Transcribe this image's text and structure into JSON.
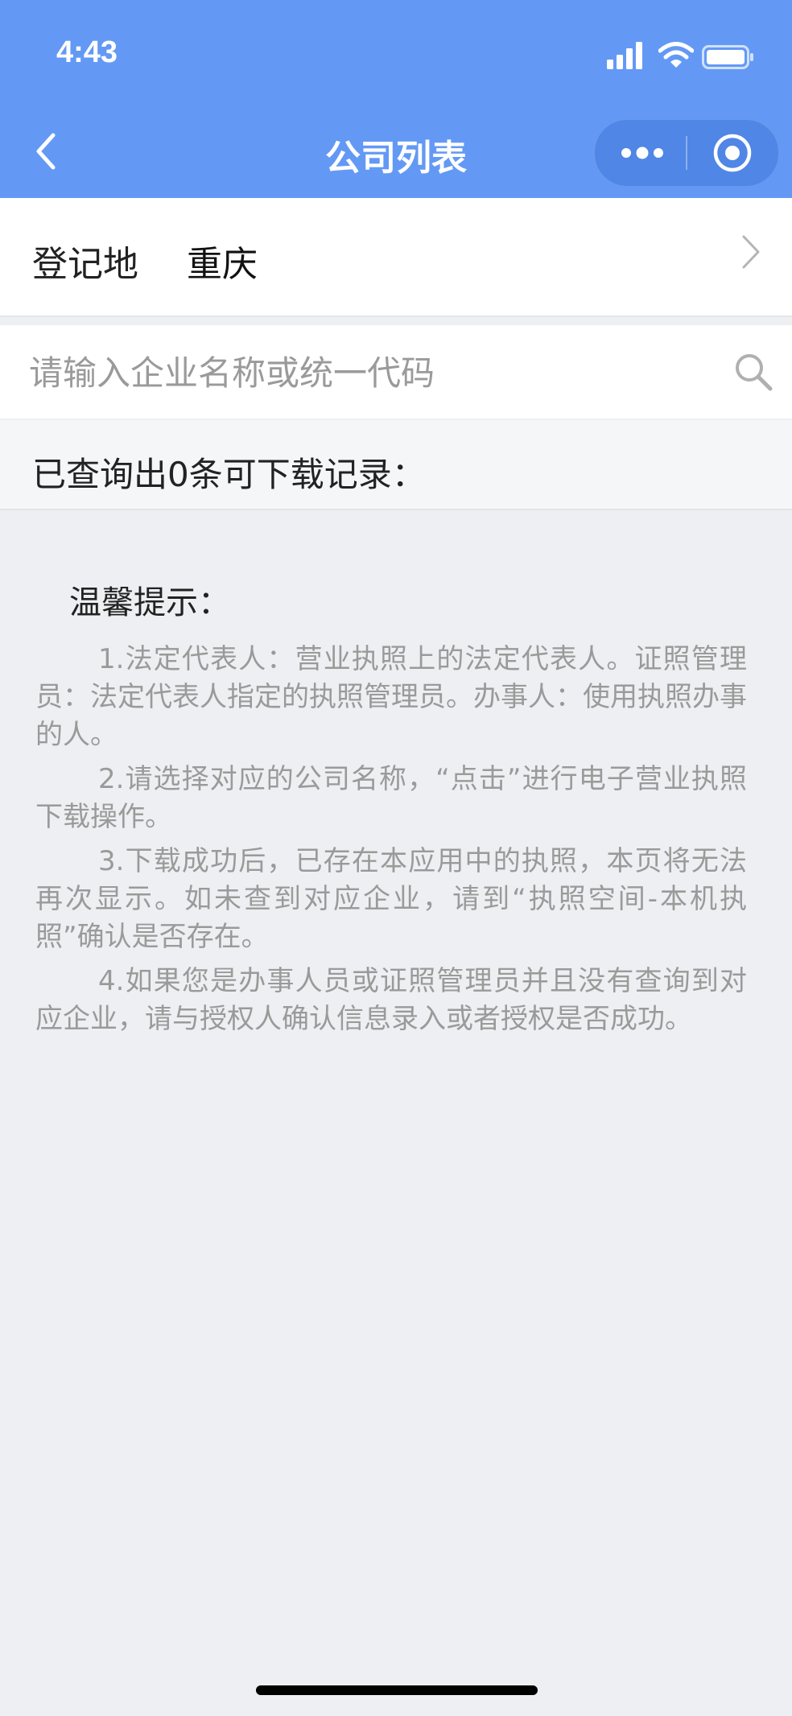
{
  "status_bar": {
    "time": "4:43"
  },
  "nav": {
    "title": "公司列表"
  },
  "region": {
    "label": "登记地",
    "value": "重庆"
  },
  "search": {
    "placeholder": "请输入企业名称或统一代码",
    "value": ""
  },
  "results": {
    "text": "已查询出0条可下载记录："
  },
  "tips": {
    "title": "温馨提示：",
    "items": [
      "1.法定代表人：营业执照上的法定代表人。证照管理员：法定代表人指定的执照管理员。办事人：使用执照办事的人。",
      "2.请选择对应的公司名称，“点击”进行电子营业执照下载操作。",
      "3.下载成功后，已存在本应用中的执照，本页将无法再次显示。如未查到对应企业，请到“执照空间-本机执照”确认是否存在。",
      "4.如果您是办事人员或证照管理员并且没有查询到对应企业，请与授权人确认信息录入或者授权是否成功。"
    ]
  },
  "colors": {
    "header": "#6399f5",
    "background": "#eeeff2"
  },
  "icons": [
    "signal-icon",
    "wifi-icon",
    "battery-icon",
    "back-arrow-icon",
    "more-dots-icon",
    "target-icon",
    "chevron-right-icon",
    "search-icon"
  ]
}
